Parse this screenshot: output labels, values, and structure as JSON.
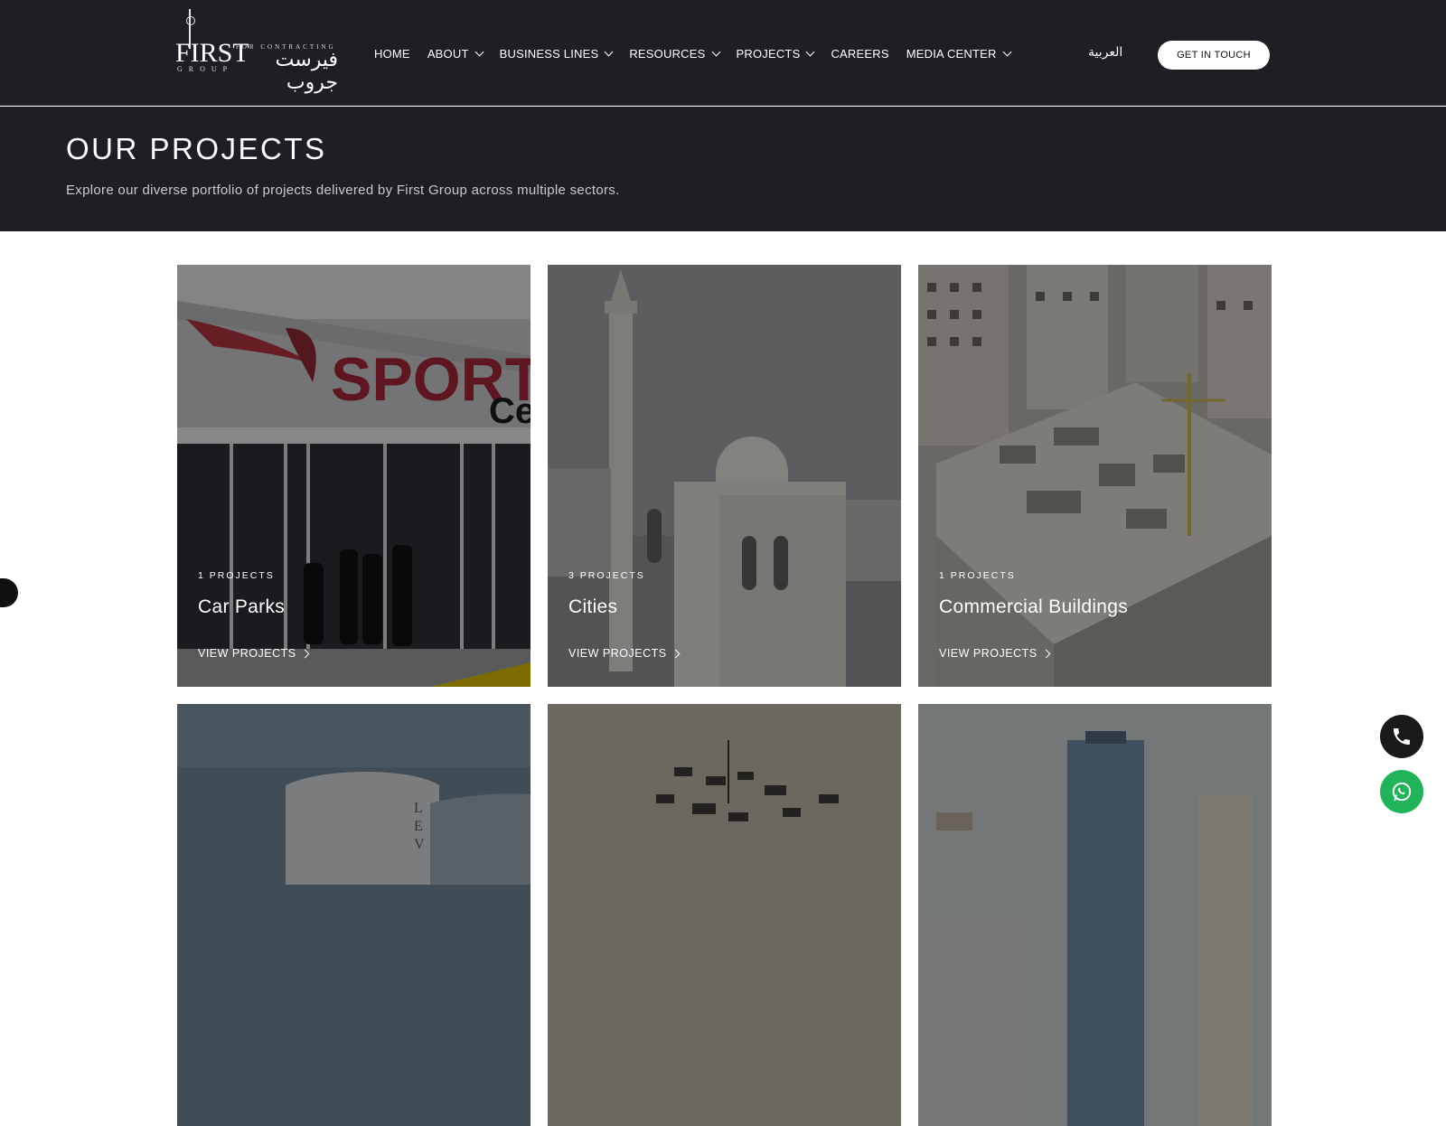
{
  "brand": {
    "name_en": "FIRST",
    "group_en": "GROUP",
    "tagline_en": "FOR CONTRACTING",
    "name_ar": "فيرست جروب"
  },
  "nav": {
    "items": [
      {
        "label": "HOME",
        "has_dropdown": false
      },
      {
        "label": "ABOUT",
        "has_dropdown": true
      },
      {
        "label": "BUSINESS LINES",
        "has_dropdown": true
      },
      {
        "label": "RESOURCES",
        "has_dropdown": true
      },
      {
        "label": "PROJECTS",
        "has_dropdown": true
      },
      {
        "label": "CAREERS",
        "has_dropdown": false
      },
      {
        "label": "MEDIA CENTER",
        "has_dropdown": true
      }
    ],
    "language_toggle": "العربية",
    "cta_label": "GET IN TOUCH"
  },
  "hero": {
    "title": "OUR PROJECTS",
    "subtitle": "Explore our diverse portfolio of projects delivered by First Group across multiple sectors."
  },
  "cards": [
    {
      "count": "1 PROJECTS",
      "title": "Car Parks",
      "link": "VIEW PROJECTS"
    },
    {
      "count": "3 PROJECTS",
      "title": "Cities",
      "link": "VIEW PROJECTS"
    },
    {
      "count": "1 PROJECTS",
      "title": "Commercial Buildings",
      "link": "VIEW PROJECTS"
    },
    {
      "count": "",
      "title": "",
      "link": ""
    },
    {
      "count": "",
      "title": "",
      "link": ""
    },
    {
      "count": "",
      "title": "",
      "link": ""
    }
  ],
  "colors": {
    "header_bg": "#1e1f24",
    "cta_bg": "#ffffff",
    "whatsapp": "#22b35a",
    "phone_button": "#1a1a1a"
  },
  "icons": {
    "phone": "phone-icon",
    "whatsapp": "whatsapp-icon",
    "chevron": "chevron-down-icon",
    "arrow": "chevron-right-icon"
  }
}
